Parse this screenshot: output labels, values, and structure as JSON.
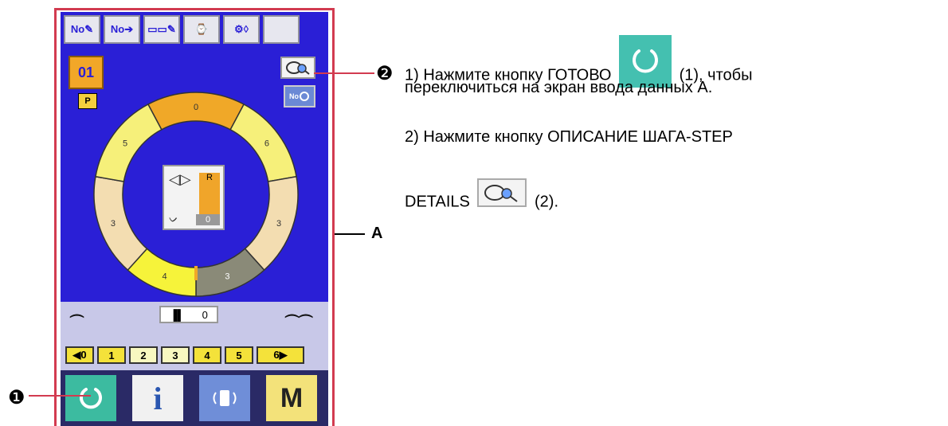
{
  "top_toolbar": {
    "buttons": [
      "No✎",
      "No➔",
      "▭▭✎",
      "⌚",
      "⚙◊",
      ""
    ]
  },
  "main": {
    "pattern_label": "01",
    "p_badge": "P"
  },
  "ring": {
    "segments": [
      {
        "label": "0",
        "color": "#f0a828"
      },
      {
        "label": "6",
        "color": "#f6f07a"
      },
      {
        "label": "3",
        "color": "#f3ddb1"
      },
      {
        "label": "3",
        "color": "#8a8a78"
      },
      {
        "label": "4",
        "color": "#f6f33a"
      },
      {
        "label": "3",
        "color": "#f3ddb1"
      },
      {
        "label": "5",
        "color": "#f6f07a"
      }
    ]
  },
  "center": {
    "icon": "◁▷",
    "right_label": "R",
    "wave": "ᨆ",
    "value": "0"
  },
  "thread": {
    "value": "0"
  },
  "numbers": [
    "◀0",
    "1",
    "2",
    "3",
    "4",
    "5",
    "6▶"
  ],
  "bottom": {
    "buttons": [
      "ready",
      "info",
      "io",
      "M"
    ]
  },
  "labels": {
    "marker1": "❶",
    "marker2": "❷",
    "A": "A"
  },
  "instructions": {
    "step1_a": "1) Нажмите кнопку ГОТОВО",
    "step1_b": " (1), чтобы",
    "step1_c": "переключиться  на экран ввода данных А.",
    "step2_a": "2) Нажмите кнопку ОПИСАНИЕ ШАГА-STEP",
    "step2_b": "DETAILS",
    "step2_c": " (2)."
  },
  "colors": {
    "panel_bg": "#2a1fd6",
    "frame": "#d23b50",
    "ready_green": "#3cbba0"
  }
}
